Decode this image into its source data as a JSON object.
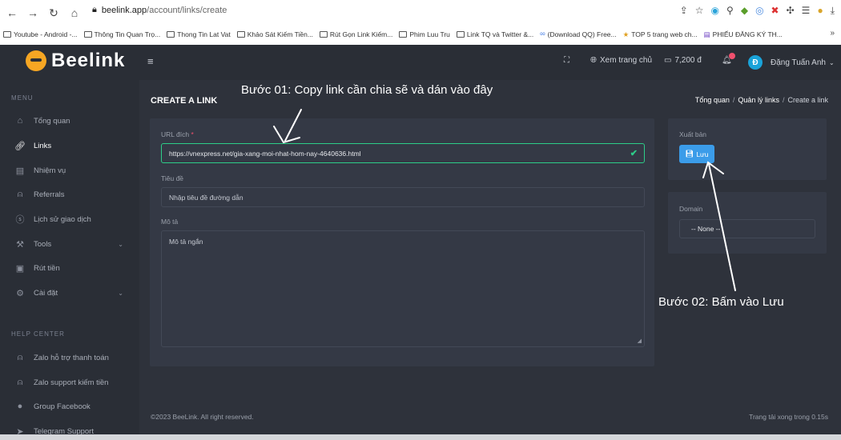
{
  "browser": {
    "url_domain": "beelink.app",
    "url_path": "/account/links/create",
    "bookmarks": [
      "Youtube - Android -...",
      "Thông Tin Quan Trọ...",
      "Thong Tin Lat Vat",
      "Khảo Sát Kiếm Tiền...",
      "Rút Gọn Link Kiếm...",
      "Phim Luu Tru",
      "Link TQ và Twitter &...",
      "(Download QQ) Free...",
      "TOP 5 trang web ch...",
      "PHIẾU ĐĂNG KÝ TH..."
    ],
    "bookmarks_more": "»"
  },
  "logo": {
    "text": "Beelink"
  },
  "sidebar": {
    "menu_heading": "MENU",
    "items": [
      {
        "label": "Tổng quan",
        "icon": "home-icon"
      },
      {
        "label": "Links",
        "icon": "link-icon"
      },
      {
        "label": "Nhiệm vụ",
        "icon": "task-icon"
      },
      {
        "label": "Referrals",
        "icon": "user-plus-icon"
      },
      {
        "label": "Lịch sử giao dịch",
        "icon": "dollar-icon"
      },
      {
        "label": "Tools",
        "icon": "tools-icon"
      },
      {
        "label": "Rút tiền",
        "icon": "wallet-icon"
      },
      {
        "label": "Cài đặt",
        "icon": "settings-icon"
      }
    ],
    "help_heading": "HELP CENTER",
    "help_items": [
      {
        "label": "Zalo hỗ trợ thanh toán",
        "icon": "support-user-icon"
      },
      {
        "label": "Zalo support kiếm tiền",
        "icon": "support-user-icon"
      },
      {
        "label": "Group Facebook",
        "icon": "facebook-icon"
      },
      {
        "label": "Telegram Support",
        "icon": "telegram-icon"
      }
    ]
  },
  "topbar": {
    "view_site": "Xem trang chủ",
    "balance": "7,200 đ",
    "user_initial": "Đ",
    "user_name": "Đặng Tuấn Anh"
  },
  "page": {
    "title": "CREATE A LINK",
    "breadcrumb": [
      "Tổng quan",
      "Quản lý links",
      "Create a link"
    ]
  },
  "form": {
    "url_label": "URL đích",
    "url_required": "*",
    "url_value": "https://vnexpress.net/gia-xang-moi-nhat-hom-nay-4640636.html",
    "title_label": "Tiêu đề",
    "title_placeholder": "Nhập tiêu đề đường dẫn",
    "desc_label": "Mô tả",
    "desc_placeholder": "Mô tả ngắn"
  },
  "publish": {
    "heading": "Xuất bản",
    "save_label": "Lưu"
  },
  "domain": {
    "heading": "Domain",
    "selected": "-- None --"
  },
  "footer": {
    "copyright": "©2023 BeeLink. All right reserved.",
    "load_time": "Trang tải xong trong 0.15s"
  },
  "annotations": {
    "step1": "Bước 01: Copy link cần chia sẽ và dán vào đây",
    "step2": "Bước 02: Bấm vào Lưu"
  },
  "colors": {
    "accent": "#3b9ce9",
    "success": "#2dce89",
    "badge": "#f0506e"
  }
}
